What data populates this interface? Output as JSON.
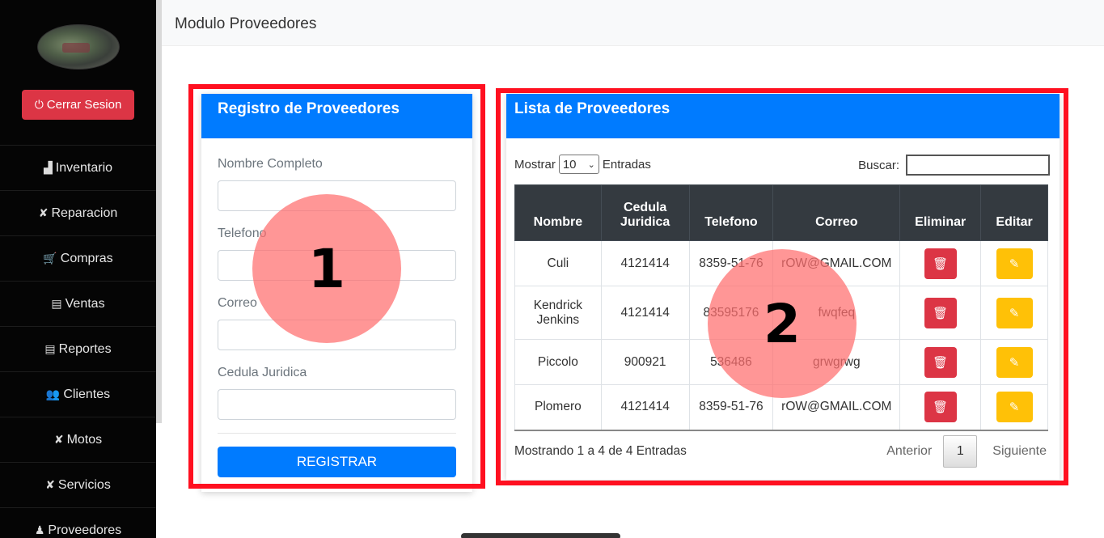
{
  "sidebar": {
    "logout_label": "Cerrar Sesion",
    "items": [
      {
        "label": "Inventario",
        "icon": "▟"
      },
      {
        "label": "Reparacion",
        "icon": "✘"
      },
      {
        "label": "Compras",
        "icon": "🛒"
      },
      {
        "label": "Ventas",
        "icon": "▤"
      },
      {
        "label": "Reportes",
        "icon": "▤"
      },
      {
        "label": "Clientes",
        "icon": "👥"
      },
      {
        "label": "Motos",
        "icon": "✘"
      },
      {
        "label": "Servicios",
        "icon": "✘"
      },
      {
        "label": "Proveedores",
        "icon": "♟"
      }
    ]
  },
  "header": {
    "title": "Modulo Proveedores"
  },
  "form": {
    "title": "Registro de Proveedores",
    "fields": [
      {
        "label": "Nombre Completo",
        "value": ""
      },
      {
        "label": "Telefono",
        "value": ""
      },
      {
        "label": "Correo",
        "value": ""
      },
      {
        "label": "Cedula Juridica",
        "value": ""
      }
    ],
    "submit_label": "REGISTRAR"
  },
  "list": {
    "title": "Lista de Proveedores",
    "show_label": "Mostrar",
    "entries_value": "10",
    "entries_label": "Entradas",
    "search_label": "Buscar:",
    "search_value": "",
    "columns": [
      "Nombre",
      "Cedula Juridica",
      "Telefono",
      "Correo",
      "Eliminar",
      "Editar"
    ],
    "rows": [
      {
        "nombre": "Culi",
        "cedula": "4121414",
        "telefono": "8359-51-76",
        "correo": "rOW@GMAIL.COM"
      },
      {
        "nombre": "Kendrick Jenkins",
        "cedula": "4121414",
        "telefono": "83595176",
        "correo": "fwqfeq"
      },
      {
        "nombre": "Piccolo",
        "cedula": "900921",
        "telefono": "536486",
        "correo": "grwgrwg"
      },
      {
        "nombre": "Plomero",
        "cedula": "4121414",
        "telefono": "8359-51-76",
        "correo": "rOW@GMAIL.COM"
      }
    ],
    "info": "Mostrando 1 a 4 de 4 Entradas",
    "prev_label": "Anterior",
    "page": "1",
    "next_label": "Siguiente"
  },
  "annotations": {
    "marker_1": "1",
    "marker_2": "2",
    "color": "#ff1020"
  }
}
